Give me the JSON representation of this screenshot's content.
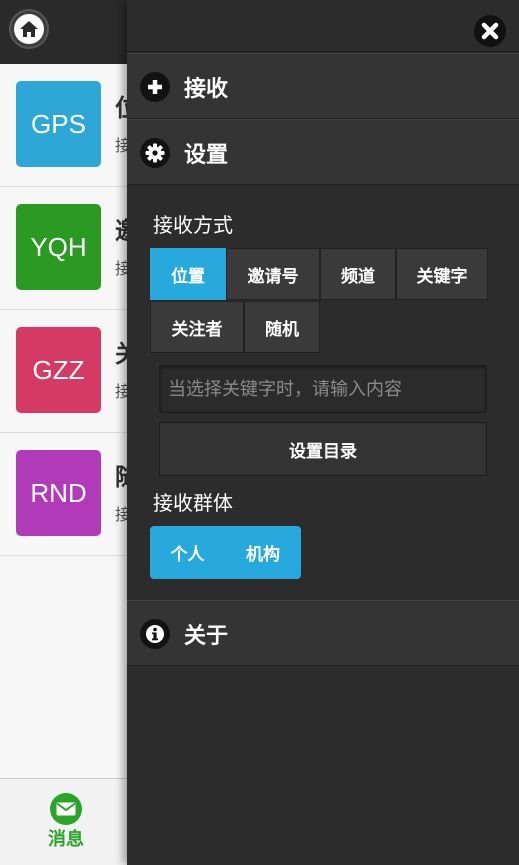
{
  "header": {
    "home_icon": "home-icon"
  },
  "list": {
    "items": [
      {
        "code": "GPS",
        "color": "#2ea7d6",
        "title": "位置",
        "subtitle": "接收位置消息"
      },
      {
        "code": "YQH",
        "color": "#2b9a22",
        "title": "邀请号",
        "subtitle": "接收邀请号消息"
      },
      {
        "code": "GZZ",
        "color": "#d43a63",
        "title": "关注者",
        "subtitle": "接收关注者消息"
      },
      {
        "code": "RND",
        "color": "#b03ab8",
        "title": "随机",
        "subtitle": "接收随机消息"
      }
    ]
  },
  "footer": {
    "label": "消息",
    "icon": "mail-icon"
  },
  "panel": {
    "close_icon": "close-icon",
    "sections": {
      "receive": {
        "label": "接收",
        "icon": "plus-icon"
      },
      "settings": {
        "label": "设置",
        "icon": "gear-icon"
      },
      "about": {
        "label": "关于",
        "icon": "info-icon"
      }
    },
    "receive_mode": {
      "label": "接收方式",
      "options": [
        "位置",
        "邀请号",
        "频道",
        "关键字",
        "关注者",
        "随机"
      ],
      "selected": "位置"
    },
    "keyword_input": {
      "placeholder": "当选择关键字时，请输入内容",
      "value": ""
    },
    "set_directory_label": "设置目录",
    "receive_group": {
      "label": "接收群体",
      "options": [
        "个人",
        "机构"
      ]
    }
  },
  "colors": {
    "accent": "#28a9de",
    "panel_bg": "#2c2c2c",
    "green": "#2aa52a"
  }
}
